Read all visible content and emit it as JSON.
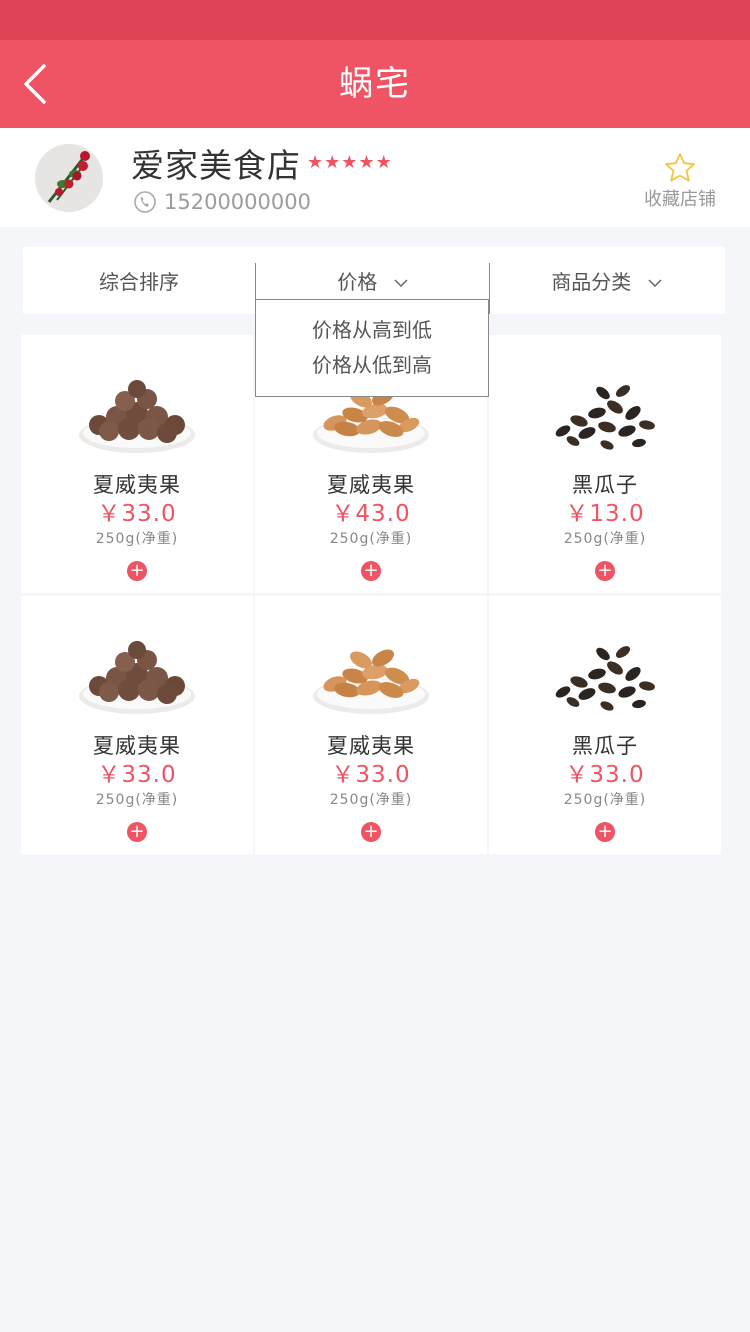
{
  "nav": {
    "title": "蜗宅",
    "back_icon": "chevron-left-icon"
  },
  "shop": {
    "name": "爱家美食店",
    "rating_stars": 5,
    "rating_max": 5,
    "phone": "15200000000",
    "favorite_label": "收藏店铺",
    "accent_color": "#ef5464"
  },
  "filters": {
    "sort_label": "综合排序",
    "price_label": "价格",
    "category_label": "商品分类"
  },
  "price_dropdown": {
    "options": [
      "价格从高到低",
      "价格从低到高"
    ]
  },
  "products": [
    {
      "name": "夏威夷果",
      "price": "￥33.0",
      "weight": "250g(净重)",
      "image": "macadamia"
    },
    {
      "name": "夏威夷果",
      "price": "￥43.0",
      "weight": "250g(净重)",
      "image": "almond"
    },
    {
      "name": "黑瓜子",
      "price": "￥13.0",
      "weight": "250g(净重)",
      "image": "black-seeds"
    },
    {
      "name": "夏威夷果",
      "price": "￥33.0",
      "weight": "250g(净重)",
      "image": "macadamia"
    },
    {
      "name": "夏威夷果",
      "price": "￥33.0",
      "weight": "250g(净重)",
      "image": "almond"
    },
    {
      "name": "黑瓜子",
      "price": "￥33.0",
      "weight": "250g(净重)",
      "image": "black-seeds"
    }
  ]
}
